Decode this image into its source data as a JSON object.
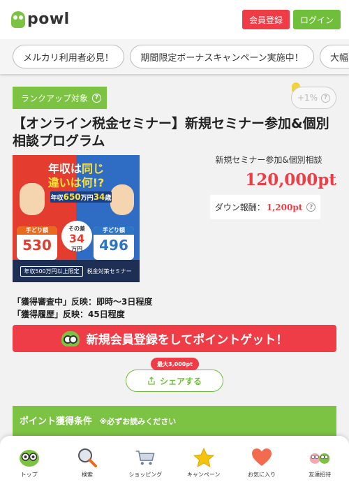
{
  "header": {
    "logo_text": "powl",
    "register_label": "会員登録",
    "login_label": "ログイン"
  },
  "campaigns": [
    {
      "label": "メルカリ利用者必見！"
    },
    {
      "label": "期間限定ボーナスキャンペーン実施中！"
    },
    {
      "label": "大幅"
    }
  ],
  "offer": {
    "rankup_label": "ランクアップ対象",
    "rate_label": "+1%",
    "title": "【オンライン税金セミナー】新規セミナー参加&個別相談プログラム",
    "subtitle": "新規セミナー参加&個別相談",
    "points": "120,000pt",
    "down_label": "ダウン報酬：",
    "down_amount": "1,200pt",
    "reflect_1": "「獲得審査中」反映：即時～3日程度",
    "reflect_2": "「獲得履歴」反映：45日程度"
  },
  "thumbnail": {
    "headline_1a": "年収は",
    "headline_1b": "同じ",
    "headline_2a": "違いは",
    "headline_2b": "何!?",
    "mid_a": "年収",
    "mid_b": "650",
    "mid_c": "万円",
    "mid_d": "34",
    "mid_e": "歳",
    "left_card_head": "手どり額",
    "left_card_num": "530",
    "right_card_head": "手どり額",
    "right_card_num": "496",
    "badge_top": "その差",
    "badge_num": "34",
    "badge_unit": "万円",
    "foot_1": "年収500万円以上限定",
    "foot_2": "税金対策セミナー"
  },
  "cta": {
    "label": "新規会員登録をしてポイントゲット！"
  },
  "share": {
    "max_label": "最大3,000pt",
    "button_label": "シェアする"
  },
  "conditions": {
    "title": "ポイント獲得条件",
    "note": "※必ずお読みください"
  },
  "bottom_nav": [
    {
      "label": "トップ"
    },
    {
      "label": "検索"
    },
    {
      "label": "ショッピング"
    },
    {
      "label": "キャンペーン"
    },
    {
      "label": "お気に入り"
    },
    {
      "label": "友達招待"
    }
  ],
  "colors": {
    "brand_green": "#7cc243",
    "accent_red": "#ef3d47"
  }
}
